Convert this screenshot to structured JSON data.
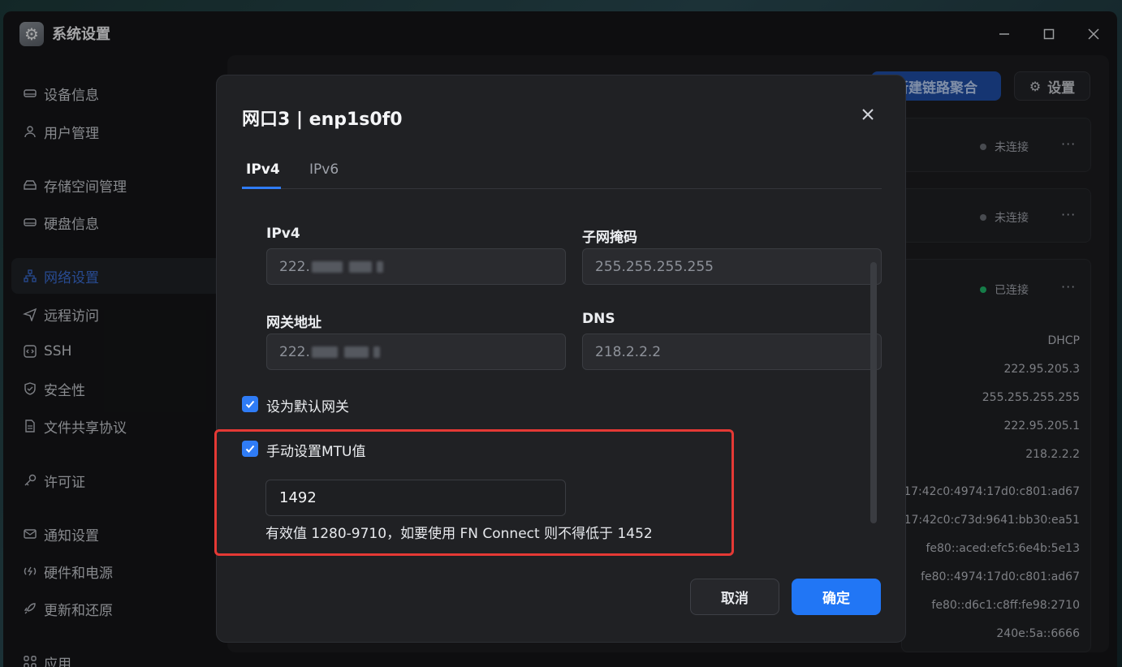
{
  "window": {
    "title": "系统设置"
  },
  "sidebar": {
    "items": [
      {
        "label": "设备信息",
        "icon": "device-icon"
      },
      {
        "label": "用户管理",
        "icon": "user-icon"
      },
      {
        "label": "存储空间管理",
        "icon": "storage-icon"
      },
      {
        "label": "硬盘信息",
        "icon": "disk-icon"
      },
      {
        "label": "网络设置",
        "icon": "network-icon",
        "active": true
      },
      {
        "label": "远程访问",
        "icon": "send-icon"
      },
      {
        "label": "SSH",
        "icon": "code-icon"
      },
      {
        "label": "安全性",
        "icon": "shield-icon"
      },
      {
        "label": "文件共享协议",
        "icon": "file-icon"
      },
      {
        "label": "许可证",
        "icon": "key-icon"
      },
      {
        "label": "通知设置",
        "icon": "mail-icon"
      },
      {
        "label": "硬件和电源",
        "icon": "power-icon"
      },
      {
        "label": "更新和还原",
        "icon": "rocket-icon"
      },
      {
        "label": "应用",
        "icon": "apps-icon"
      }
    ]
  },
  "main": {
    "new_aggregation_label": "新建链路聚合",
    "settings_label": "设置",
    "cards": [
      {
        "status": "未连接",
        "status_color": "#6b6f76"
      },
      {
        "status": "未连接",
        "status_color": "#6b6f76"
      },
      {
        "status": "已连接",
        "status_color": "#1fb76a"
      }
    ],
    "more_label": "···",
    "details": [
      "DHCP",
      "222.95.205.3",
      "255.255.255.255",
      "222.95.205.1",
      "218.2.2.2",
      "17:42c0:4974:17d0:c801:ad67",
      "17:42c0:c73d:9641:bb30:ea51",
      "fe80::aced:efc5:6e4b:5e13",
      "fe80::4974:17d0:c801:ad67",
      "fe80::d6c1:c8ff:fe98:2710",
      "240e:5a::6666"
    ]
  },
  "modal": {
    "title": "网口3 | enp1s0f0",
    "tabs": [
      "IPv4",
      "IPv6"
    ],
    "fields": {
      "ipv4_label": "IPv4",
      "ipv4_value": "222.",
      "mask_label": "子网掩码",
      "mask_value": "255.255.255.255",
      "gateway_label": "网关地址",
      "gateway_value": "222.",
      "dns_label": "DNS",
      "dns_value": "218.2.2.2"
    },
    "default_gateway_label": "设为默认网关",
    "mtu_label": "手动设置MTU值",
    "mtu_value": "1492",
    "mtu_hint": "有效值 1280-9710，如要使用 FN Connect 则不得低于 1452",
    "cancel_label": "取消",
    "ok_label": "确定"
  },
  "colors": {
    "accent": "#2f7cf6",
    "connected": "#1fb76a",
    "highlight": "#e53935"
  }
}
